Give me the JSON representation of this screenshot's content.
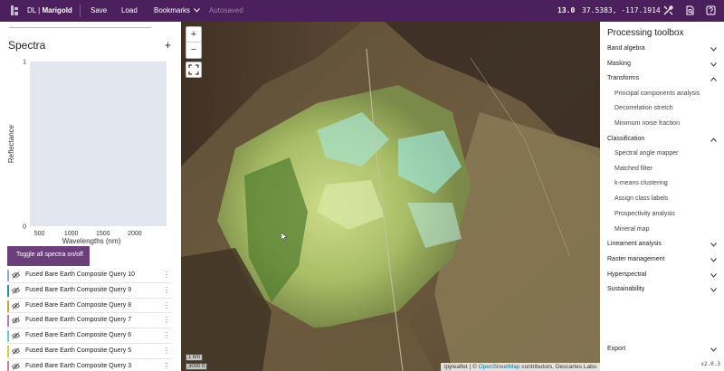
{
  "topbar": {
    "brand_prefix": "DL",
    "brand_sep": "|",
    "brand_name": "Marigold",
    "save": "Save",
    "load": "Load",
    "bookmarks": "Bookmarks",
    "autosave_status": "Autosaved",
    "zoom_level": "13.0",
    "coordinates": "37.5383, -117.1914",
    "icons": [
      "tools-icon",
      "document-search-icon",
      "help-icon"
    ]
  },
  "spectra": {
    "title": "Spectra",
    "add_label": "+",
    "toggle_label": "Toggle all spectra on/off"
  },
  "chart_data": {
    "type": "line",
    "xlabel": "Wavelengths (nm)",
    "ylabel": "Reflectance",
    "x_ticks": [
      "500",
      "1000",
      "1500",
      "2000"
    ],
    "y_ticks": [
      "0",
      "1"
    ],
    "xlim": [
      350,
      2500
    ],
    "ylim": [
      0,
      1
    ],
    "series": []
  },
  "layers": [
    {
      "name": "Fused Bare Earth Composite Query 10",
      "color": "#9aa0d8"
    },
    {
      "name": "Fused Bare Earth Composite Query 9",
      "color": "#2f8f8f"
    },
    {
      "name": "Fused Bare Earth Composite Query 8",
      "color": "#c9a24a"
    },
    {
      "name": "Fused Bare Earth Composite Query 7",
      "color": "#b07cc6"
    },
    {
      "name": "Fused Bare Earth Composite Query 6",
      "color": "#6cc6e0"
    },
    {
      "name": "Fused Bare Earth Composite Query 5",
      "color": "#d8c84a"
    },
    {
      "name": "Fused Bare Earth Composite Query 3",
      "color": "#d47a9a"
    }
  ],
  "map": {
    "zoom_in": "+",
    "zoom_out": "−",
    "scale_metric": "1 km",
    "scale_imperial": "3000 ft",
    "attribution_prefix": "ipyleaflet | ©",
    "attribution_link": "OpenStreetMap",
    "attribution_suffix": "contributors, Descartes Labs"
  },
  "toolbox": {
    "title": "Processing toolbox",
    "band_algebra": "Band algebra",
    "masking": "Masking",
    "transforms": "Transforms",
    "transforms_items": [
      "Principal components analysis",
      "Decorrelation stretch",
      "Minimum noise fraction"
    ],
    "classification": "Classification",
    "classification_items": [
      "Spectral angle mapper",
      "Matched filter",
      "k-means clustering",
      "Assign class labels",
      "Prospectivity analysis",
      "Mineral map"
    ],
    "lineament": "Lineament analysis",
    "raster": "Raster management",
    "hyperspectral": "Hyperspectral",
    "sustainability": "Sustainability",
    "export": "Export",
    "version": "v2.0.3"
  }
}
